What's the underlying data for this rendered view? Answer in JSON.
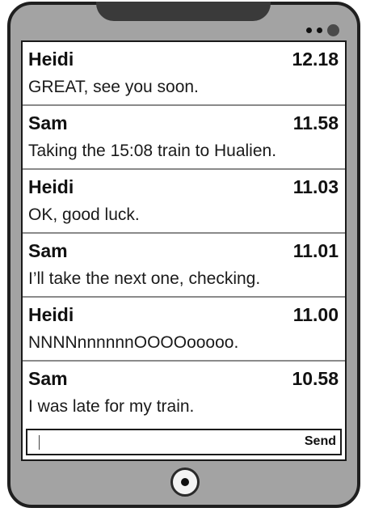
{
  "messages": [
    {
      "sender": "Heidi",
      "time": "12.18",
      "text": "GREAT, see you soon."
    },
    {
      "sender": "Sam",
      "time": "11.58",
      "text": "Taking the 15:08 train to Hualien."
    },
    {
      "sender": "Heidi",
      "time": "11.03",
      "text": "OK, good luck."
    },
    {
      "sender": "Sam",
      "time": "11.01",
      "text": "I’ll take the next one, checking."
    },
    {
      "sender": "Heidi",
      "time": "11.00",
      "text": "NNNNnnnnnnOOOOooooo."
    },
    {
      "sender": "Sam",
      "time": "10.58",
      "text": "I was late for my train."
    }
  ],
  "composer": {
    "value": "",
    "send_label": "Send"
  },
  "colors": {
    "phone_body": "#a3a3a3",
    "phone_border": "#1f1f1f",
    "screen_bg": "#ffffff",
    "divider": "#8a8a8a"
  },
  "icons": {
    "status": "status-dots-icon",
    "home": "home-button-icon"
  }
}
